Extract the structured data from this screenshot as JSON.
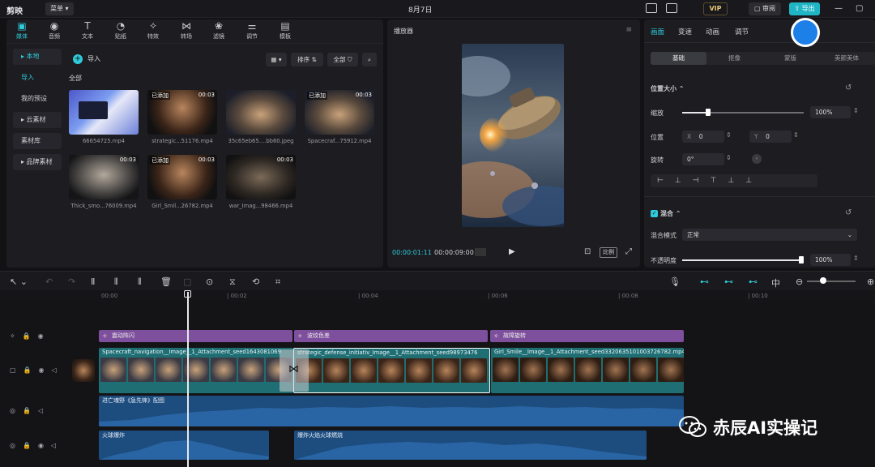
{
  "app": {
    "name": "剪映",
    "menu_label": "菜单",
    "date": "8月7日",
    "vip_label": "VIP",
    "review_label": "审阅",
    "export_label": "导出"
  },
  "media_tabs": [
    {
      "label": "媒体",
      "icon": "media-icon"
    },
    {
      "label": "音频",
      "icon": "audio-icon"
    },
    {
      "label": "文本",
      "icon": "text-icon"
    },
    {
      "label": "贴纸",
      "icon": "sticker-icon"
    },
    {
      "label": "特效",
      "icon": "effects-icon"
    },
    {
      "label": "转场",
      "icon": "transition-icon"
    },
    {
      "label": "滤镜",
      "icon": "filter-icon"
    },
    {
      "label": "调节",
      "icon": "adjust-icon"
    },
    {
      "label": "模板",
      "icon": "template-icon"
    }
  ],
  "sidebar": {
    "items": [
      "▸ 本地",
      "导入",
      "我的预设",
      "▸ 云素材",
      "素材库",
      "▸ 品牌素材"
    ]
  },
  "media": {
    "import_label": "导入",
    "all_label": "全部",
    "sort_label": "排序",
    "filter_label": "全部",
    "items": [
      {
        "name": "66654725.mp4",
        "badge": "",
        "duration": ""
      },
      {
        "name": "strategic...51176.mp4",
        "badge": "已添加",
        "duration": "00:03"
      },
      {
        "name": "35c65eb65....bb60.jpeg",
        "badge": "",
        "duration": ""
      },
      {
        "name": "Spacecraf...75912.mp4",
        "badge": "已添加",
        "duration": "00:03"
      },
      {
        "name": "Thick_smo...76009.mp4",
        "badge": "",
        "duration": "00:03"
      },
      {
        "name": "Girl_Smil...26782.mp4",
        "badge": "已添加",
        "duration": "00:03"
      },
      {
        "name": "war_Imag...98466.mp4",
        "badge": "",
        "duration": "00:03"
      }
    ]
  },
  "player": {
    "title": "播放器",
    "time_current": "00:00:01:11",
    "time_total": "00:00:09:00",
    "ratio_label": "比例"
  },
  "props": {
    "tabs": [
      "画面",
      "变速",
      "动画",
      "调节"
    ],
    "subtabs": [
      "基础",
      "抠像",
      "蒙版",
      "美颜美体"
    ],
    "position_size_label": "位置大小",
    "scale_label": "缩放",
    "scale_value": "100%",
    "scale_fraction": 0.2,
    "position_label": "位置",
    "x_label": "X",
    "x_value": "0",
    "y_label": "Y",
    "y_value": "0",
    "rotate_label": "旋转",
    "rotate_value": "0°",
    "blend_label": "混合",
    "blend_mode_label": "混合模式",
    "blend_mode_value": "正常",
    "opacity_label": "不透明度",
    "opacity_value": "100%",
    "opacity_fraction": 1.0
  },
  "timeline": {
    "ruler": [
      "00:00",
      "| 00:02",
      "| 00:04",
      "| 00:06",
      "| 00:08",
      "| 00:10"
    ],
    "effects": [
      "震动阵闪",
      "波纹色差",
      "故障旋转"
    ],
    "video_clips": [
      "Spacecraft_navigation__Image__1_Attachment_seed1643081069",
      "strategic_defense_initiativ_Image__1_Attachment_seed98973476",
      "Girl_Smile__Image__1_Attachment_seed3320635101003726782.mp4"
    ],
    "audio_main": "进亡魂野《急先锋》配图",
    "audio_sfx": [
      "火球爆炸",
      "爆炸火焰火球燃烧"
    ]
  },
  "watermark": {
    "text": "赤辰AI实操记"
  }
}
